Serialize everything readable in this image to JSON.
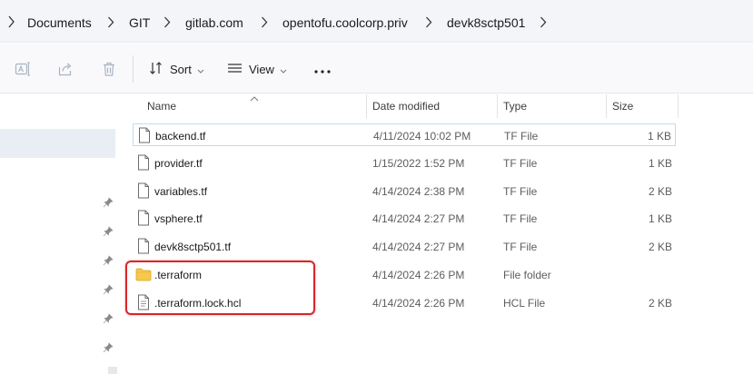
{
  "breadcrumb": [
    "Documents",
    "GIT",
    "gitlab.com",
    "opentofu.coolcorp.priv",
    "devk8sctp501"
  ],
  "toolbar": {
    "sort_label": "Sort",
    "view_label": "View",
    "more_label": "···"
  },
  "columns": {
    "name": "Name",
    "date": "Date modified",
    "type": "Type",
    "size": "Size"
  },
  "files": [
    {
      "name": "backend.tf",
      "date": "4/11/2024 10:02 PM",
      "type": "TF File",
      "size": "1 KB",
      "icon": "file-icon"
    },
    {
      "name": "provider.tf",
      "date": "1/15/2022 1:52 PM",
      "type": "TF File",
      "size": "1 KB",
      "icon": "file-icon"
    },
    {
      "name": "variables.tf",
      "date": "4/14/2024 2:38 PM",
      "type": "TF File",
      "size": "2 KB",
      "icon": "file-icon"
    },
    {
      "name": "vsphere.tf",
      "date": "4/14/2024 2:27 PM",
      "type": "TF File",
      "size": "1 KB",
      "icon": "file-icon"
    },
    {
      "name": "devk8sctp501.tf",
      "date": "4/14/2024 2:27 PM",
      "type": "TF File",
      "size": "2 KB",
      "icon": "file-icon"
    },
    {
      "name": ".terraform",
      "date": "4/14/2024 2:26 PM",
      "type": "File folder",
      "size": "",
      "icon": "folder-icon"
    },
    {
      "name": ".terraform.lock.hcl",
      "date": "4/14/2024 2:26 PM",
      "type": "HCL File",
      "size": "2 KB",
      "icon": "hcl-file-icon"
    }
  ],
  "colors": {
    "highlight": "#d9262a",
    "folder": "#f4c542",
    "selection_border": "#c2dcec",
    "nav_selected": "#e9eef5"
  }
}
